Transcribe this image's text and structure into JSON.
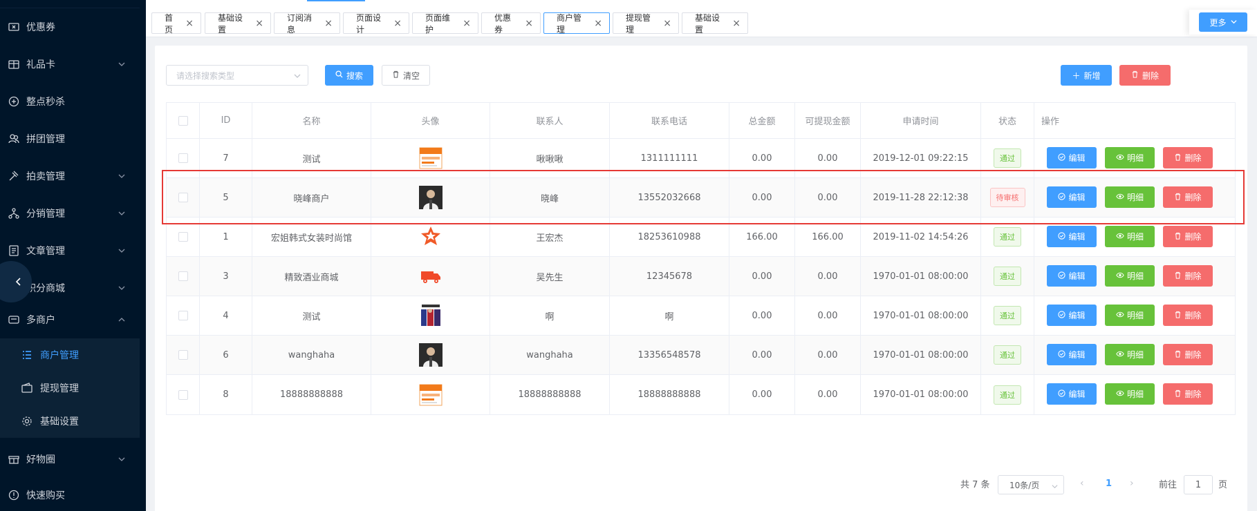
{
  "sidebar": {
    "items": [
      {
        "label": "优惠券",
        "icon": "coupon-icon",
        "chevron": false
      },
      {
        "label": "礼品卡",
        "icon": "gift-card-icon",
        "chevron": true
      },
      {
        "label": "整点秒杀",
        "icon": "flash-sale-icon",
        "chevron": false
      },
      {
        "label": "拼团管理",
        "icon": "group-buy-icon",
        "chevron": false
      },
      {
        "label": "拍卖管理",
        "icon": "auction-icon",
        "chevron": true
      },
      {
        "label": "分销管理",
        "icon": "distribution-icon",
        "chevron": true
      },
      {
        "label": "文章管理",
        "icon": "article-icon",
        "chevron": true
      },
      {
        "label": "积分商城",
        "icon": "points-store-icon",
        "chevron": true
      },
      {
        "label": "多商户",
        "icon": "multi-merchant-icon",
        "chevron": true
      }
    ],
    "sub_items": [
      {
        "label": "商户管理",
        "icon": "list-icon",
        "active": true
      },
      {
        "label": "提现管理",
        "icon": "wallet-icon",
        "active": false
      },
      {
        "label": "基础设置",
        "icon": "gear-icon",
        "active": false
      }
    ],
    "bottom_items": [
      {
        "label": "好物圈",
        "icon": "circle-icon",
        "chevron": true
      },
      {
        "label": "快速购买",
        "icon": "quick-buy-icon",
        "chevron": false
      }
    ]
  },
  "tabs": [
    {
      "label": "首页",
      "active": false
    },
    {
      "label": "基础设置",
      "active": false
    },
    {
      "label": "订阅消息",
      "active": false
    },
    {
      "label": "页面设计",
      "active": false
    },
    {
      "label": "页面维护",
      "active": false
    },
    {
      "label": "优惠券",
      "active": false
    },
    {
      "label": "商户管理",
      "active": true
    },
    {
      "label": "提现管理",
      "active": false
    },
    {
      "label": "基础设置",
      "active": false
    }
  ],
  "more_label": "更多",
  "toolbar": {
    "search_placeholder": "请选择搜索类型",
    "search_label": "搜索",
    "clear_label": "清空",
    "add_label": "新增",
    "delete_label": "删除"
  },
  "table": {
    "headers": [
      "ID",
      "名称",
      "头像",
      "联系人",
      "联系电话",
      "总金额",
      "可提现金额",
      "申请时间",
      "状态",
      "操作"
    ],
    "rows": [
      {
        "id": "7",
        "name": "测试",
        "avatar": "orange-card",
        "contact": "啾啾啾",
        "phone": "1311111111",
        "total": "0.00",
        "withdrawable": "0.00",
        "time": "2019-12-01 09:22:15",
        "status": "通过",
        "status_type": "pass"
      },
      {
        "id": "5",
        "name": "晓峰商户",
        "avatar": "person-photo",
        "contact": "晓峰",
        "phone": "13552032668",
        "total": "0.00",
        "withdrawable": "0.00",
        "time": "2019-11-28 22:12:38",
        "status": "待审核",
        "status_type": "wait"
      },
      {
        "id": "1",
        "name": "宏姐韩式女装时尚馆",
        "avatar": "star-badge",
        "contact": "王宏杰",
        "phone": "18253610988",
        "total": "166.00",
        "withdrawable": "166.00",
        "time": "2019-11-02 14:54:26",
        "status": "通过",
        "status_type": "pass"
      },
      {
        "id": "3",
        "name": "精致酒业商城",
        "avatar": "truck",
        "contact": "吴先生",
        "phone": "12345678",
        "total": "0.00",
        "withdrawable": "0.00",
        "time": "1970-01-01 08:00:00",
        "status": "通过",
        "status_type": "pass"
      },
      {
        "id": "4",
        "name": "测试",
        "avatar": "clothing-photo",
        "contact": "啊",
        "phone": "啊",
        "total": "0.00",
        "withdrawable": "0.00",
        "time": "1970-01-01 08:00:00",
        "status": "通过",
        "status_type": "pass"
      },
      {
        "id": "6",
        "name": "wanghaha",
        "avatar": "person-photo",
        "contact": "wanghaha",
        "phone": "13356548578",
        "total": "0.00",
        "withdrawable": "0.00",
        "time": "1970-01-01 08:00:00",
        "status": "通过",
        "status_type": "pass"
      },
      {
        "id": "8",
        "name": "18888888888",
        "avatar": "orange-card",
        "contact": "18888888888",
        "phone": "18888888888",
        "total": "0.00",
        "withdrawable": "0.00",
        "time": "1970-01-01 08:00:00",
        "status": "通过",
        "status_type": "pass"
      }
    ],
    "actions": {
      "edit": "编辑",
      "detail": "明细",
      "delete": "删除"
    }
  },
  "pagination": {
    "total_text": "共 7 条",
    "page_size": "10条/页",
    "current_page": "1",
    "goto_prefix": "前往",
    "goto_value": "1",
    "goto_suffix": "页"
  },
  "colors": {
    "primary": "#409eff",
    "success": "#67c23a",
    "danger": "#f56c6c",
    "sidebar_bg": "#001529",
    "highlight": "#e53935"
  }
}
